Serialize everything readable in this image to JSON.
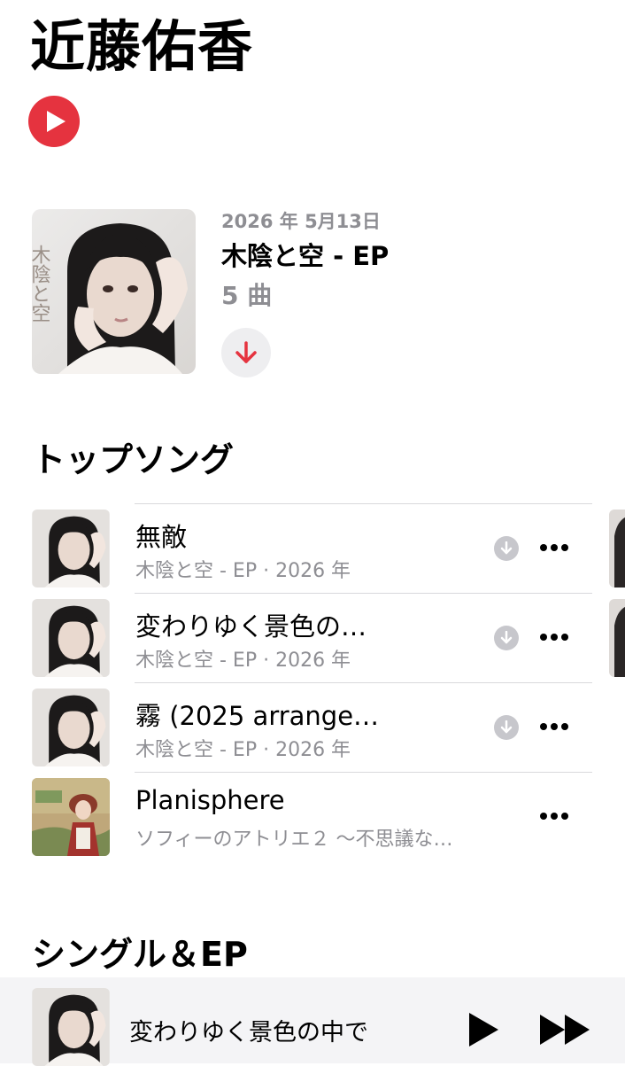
{
  "artist": {
    "name": "近藤佑香"
  },
  "play_button": {
    "icon": "play-icon",
    "color": "#e5333f"
  },
  "latest_release": {
    "date": "2026 年 5月13日",
    "title": "木陰と空 - EP",
    "track_count": "5 曲",
    "download_icon": "arrow-down-icon",
    "cover_caption": "木陰と空"
  },
  "top_songs": {
    "heading": "トップソング",
    "items": [
      {
        "title": "無敵",
        "subtitle": "木陰と空 - EP · 2026 年",
        "downloadable": true,
        "art": "kokage"
      },
      {
        "title": "変わりゆく景色の…",
        "subtitle": "木陰と空 - EP · 2026 年",
        "downloadable": true,
        "art": "kokage"
      },
      {
        "title": "霧 (2025 arrange…",
        "subtitle": "木陰と空 - EP · 2026 年",
        "downloadable": true,
        "art": "kokage"
      },
      {
        "title": "Planisphere",
        "subtitle": "ソフィーのアトリエ２ 〜不思議な…",
        "downloadable": false,
        "art": "atelier"
      }
    ]
  },
  "singles": {
    "heading": "シングル＆EP"
  },
  "now_playing": {
    "title": "変わりゆく景色の中で",
    "play_icon": "play-icon",
    "next_icon": "fast-forward-icon"
  }
}
